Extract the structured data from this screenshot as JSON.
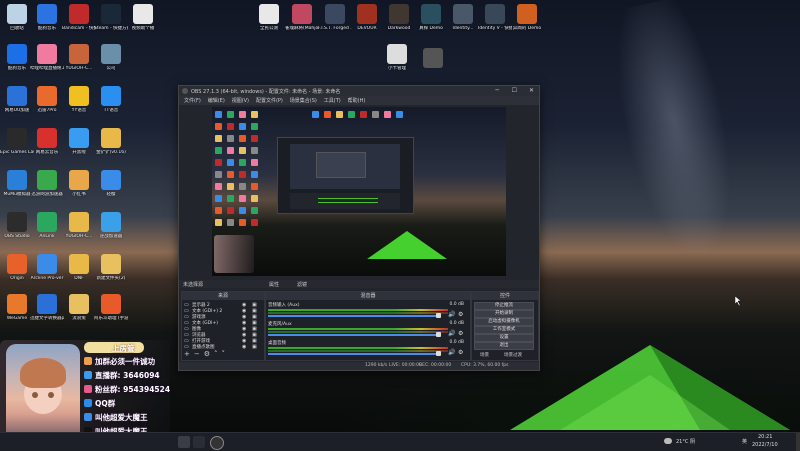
{
  "desktop_icons": [
    {
      "label": "回收站",
      "color": "#bcd3e6"
    },
    {
      "label": "酷狗音乐",
      "color": "#2a73e0"
    },
    {
      "label": "Bandicam - 快捷方式",
      "color": "#c12a2a"
    },
    {
      "label": "Steam - 快捷方式",
      "color": "#1b2838"
    },
    {
      "label": "视频助个播",
      "color": "#e8e8e8"
    },
    {
      "label": "酷狗音乐",
      "color": "#1d6fe8"
    },
    {
      "label": "哔哩哔哩直播姬工具",
      "color": "#f07aa0"
    },
    {
      "label": "YUGIOH-C...",
      "color": "#c8643c"
    },
    {
      "label": "公司",
      "color": "#6b8fa8"
    },
    {
      "label": "网易UU加速",
      "color": "#2b72d8"
    },
    {
      "label": "迅雷7Pro",
      "color": "#e86a2c"
    },
    {
      "label": "YY语音",
      "color": "#f0c020"
    },
    {
      "label": "TT语音",
      "color": "#2a8ff0"
    },
    {
      "label": "Epic Games Launcher",
      "color": "#2a2a2a"
    },
    {
      "label": "网易云音乐",
      "color": "#d8302c"
    },
    {
      "label": "开黑啦",
      "color": "#3a9cf0"
    },
    {
      "label": "金铲铲(v0.16)",
      "color": "#e8b848"
    },
    {
      "label": "MuMu模拟器",
      "color": "#2a80d8"
    },
    {
      "label": "迅游网游加速器",
      "color": "#3aa84c"
    },
    {
      "label": "小红书",
      "color": "#e8a84a"
    },
    {
      "label": "轻樱",
      "color": "#3a8ce8"
    },
    {
      "label": "OBS Studio",
      "color": "#2c2c2c"
    },
    {
      "label": "AnLink",
      "color": "#2aa860"
    },
    {
      "label": "YUGIOH-C...",
      "color": "#e8b848"
    },
    {
      "label": "逆战加速器",
      "color": "#3aa0e8"
    },
    {
      "label": "Origin",
      "color": "#e8602a"
    },
    {
      "label": "Arcline Pro-ver",
      "color": "#3a8ce8"
    },
    {
      "label": "DNF",
      "color": "#e8b848"
    },
    {
      "label": "新建文件夹(2)",
      "color": "#e8c060"
    },
    {
      "label": "WeGame",
      "color": "#e8782a"
    },
    {
      "label": "迅捷文字转换器pc-sgfx",
      "color": "#2a70d8"
    },
    {
      "label": "流浪兔",
      "color": "#e8c060"
    },
    {
      "label": "阿乐斗助理 (手游模拟器)",
      "color": "#e85a2a"
    }
  ],
  "top_icons": [
    {
      "label": "全民公测",
      "color": "#e8e8e8"
    },
    {
      "label": "雀魂麻将(Mahjong...",
      "color": "#c04860"
    },
    {
      "label": "F.I.S.T. Forged ...",
      "color": "#3a4860"
    },
    {
      "label": "DEVOUR",
      "color": "#a03020"
    },
    {
      "label": "Darkwood",
      "color": "#403830"
    },
    {
      "label": "真探 Demo",
      "color": "#2a5060"
    },
    {
      "label": "Identity...",
      "color": "#485868"
    },
    {
      "label": "Identity V - 快捷方式",
      "color": "#384858"
    },
    {
      "label": "异闻的 Demo",
      "color": "#d06020"
    },
    {
      "label": "小卡管理",
      "color": "#dddddd"
    },
    {
      "label": "",
      "color": "#555555"
    }
  ],
  "obs": {
    "title": "OBS 27.1.3 (64-bit, windows) - 配置文件: 未命名 - 场景: 未命名",
    "menu": [
      "文件(F)",
      "编辑(E)",
      "视图(V)",
      "配置文件(P)",
      "场景集合(S)",
      "工具(T)",
      "帮助(H)"
    ],
    "scene_label": "未选择源",
    "props_label": "属性",
    "filters_label": "滤镜",
    "sources_header": "来源",
    "mixer_header": "混音器",
    "controls_header": "控件",
    "sources": [
      "显示器 2",
      "文本 (GDI+) 2",
      "游戏源",
      "文本 (GDI+)",
      "图像",
      "浏览器",
      "打开游戏",
      "直播点歌图"
    ],
    "mixer": [
      {
        "name": "音频输入 (Aux)",
        "level": "0.0 dB"
      },
      {
        "name": "麦克风/Aux",
        "level": "0.0 dB"
      },
      {
        "name": "桌面音频",
        "level": "0.0 dB"
      }
    ],
    "controls": [
      "停止推流",
      "开始录制",
      "启动虚拟摄像机",
      "工作室模式",
      "设置",
      "退出"
    ],
    "ctrl_bottom": [
      "场景",
      "场景过渡"
    ],
    "status": {
      "live": "LIVE: 00:00:00",
      "rec": "REC: 00:00:00",
      "cpu": "CPU: 3.7%, 60.00 fps",
      "kb": "1290 kb/s"
    }
  },
  "overlay": {
    "name": "上房管",
    "rows": [
      {
        "text": "加群必须一件诚功",
        "color": "#f0a04c"
      },
      {
        "text": "直播群: 3646094",
        "color": "#3a9cf0"
      },
      {
        "text": "粉丝群: 954394524",
        "color": "#e85a8c"
      },
      {
        "text": "QQ群",
        "color": "#2a8ce8"
      },
      {
        "text": "叫他超爱大魔王",
        "color": "#3a8ce8"
      },
      {
        "text": "叫他超爱大魔王",
        "color": "#111111"
      }
    ]
  },
  "taskbar": {
    "weather": "21°C 阴",
    "lang": "英",
    "time": "20:21",
    "date": "2022/7/10"
  }
}
